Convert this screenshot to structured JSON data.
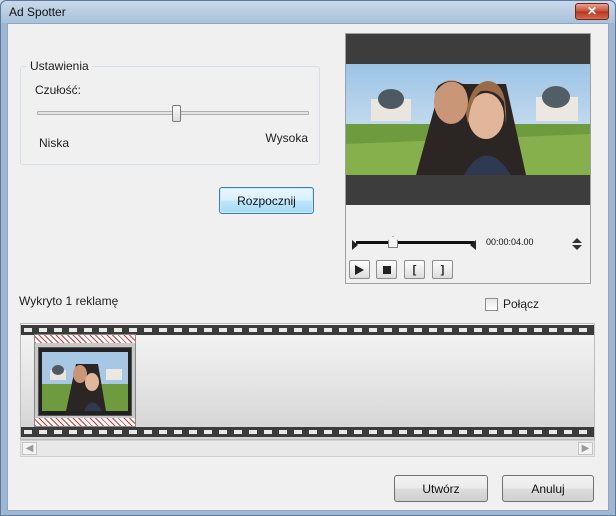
{
  "window": {
    "title": "Ad Spotter",
    "close_glyph": "✕"
  },
  "settings": {
    "group_label": "Ustawienia",
    "sensitivity_label": "Czułość:",
    "low_label": "Niska",
    "high_label": "Wysoka",
    "sensitivity_value": 0.53
  },
  "buttons": {
    "start": "Rozpocznij",
    "create": "Utwórz",
    "cancel": "Anuluj"
  },
  "player": {
    "time": "00:00:04.00",
    "position": 0.3,
    "controls": {
      "in_glyph": "[",
      "out_glyph": "]"
    }
  },
  "results": {
    "detected_text": "Wykryto 1 reklamę",
    "merge_label": "Połącz",
    "merge_checked": false
  },
  "scroll": {
    "left_glyph": "◀",
    "right_glyph": "▶"
  },
  "icons": [
    "close-icon",
    "play-icon",
    "stop-icon",
    "mark-in-icon",
    "mark-out-icon",
    "spin-up-icon",
    "spin-down-icon"
  ]
}
